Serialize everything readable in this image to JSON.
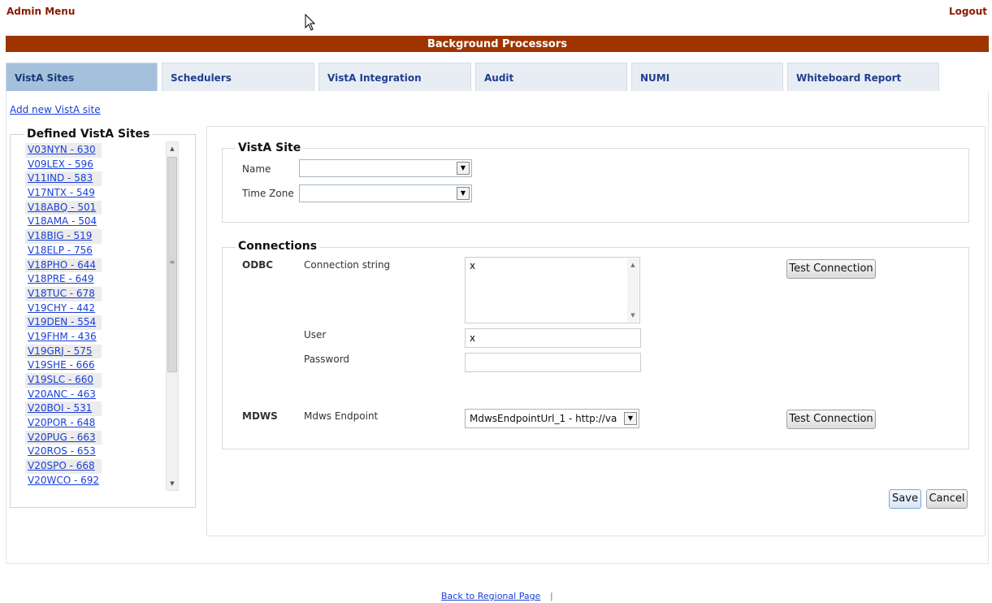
{
  "header": {
    "admin_menu": "Admin Menu",
    "logout": "Logout",
    "title": "Background Processors"
  },
  "tabs": [
    {
      "label": "VistA Sites",
      "active": true
    },
    {
      "label": "Schedulers",
      "active": false
    },
    {
      "label": "VistA Integration",
      "active": false
    },
    {
      "label": "Audit",
      "active": false
    },
    {
      "label": "NUMI",
      "active": false
    },
    {
      "label": "Whiteboard Report",
      "active": false
    }
  ],
  "add_site_link": "Add new VistA site",
  "sites": {
    "legend": "Defined VistA Sites",
    "items": [
      "V03NYN - 630",
      "V09LEX - 596",
      "V11IND - 583",
      "V17NTX - 549",
      "V18ABQ - 501",
      "V18AMA - 504",
      "V18BIG - 519",
      "V18ELP - 756",
      "V18PHO - 644",
      "V18PRE - 649",
      "V18TUC - 678",
      "V19CHY - 442",
      "V19DEN - 554",
      "V19FHM - 436",
      "V19GRJ - 575",
      "V19SHE - 666",
      "V19SLC - 660",
      "V20ANC - 463",
      "V20BOI - 531",
      "V20POR - 648",
      "V20PUG - 663",
      "V20ROS - 653",
      "V20SPO - 668",
      "V20WCO - 692"
    ]
  },
  "vista_site": {
    "legend": "VistA Site",
    "name_label": "Name",
    "name_value": "",
    "timezone_label": "Time Zone",
    "timezone_value": ""
  },
  "connections": {
    "legend": "Connections",
    "odbc_label": "ODBC",
    "connection_string_label": "Connection string",
    "connection_string_value": "x",
    "user_label": "User",
    "user_value": "x",
    "password_label": "Password",
    "password_value": "",
    "test_connection_label": "Test Connection",
    "mdws_label": "MDWS",
    "mdws_endpoint_label": "Mdws Endpoint",
    "mdws_endpoint_value": "MdwsEndpointUrl_1 - http://va"
  },
  "actions": {
    "save": "Save",
    "cancel": "Cancel"
  },
  "footer": {
    "back_link": "Back to Regional Page",
    "separator": "|"
  },
  "colors": {
    "title_bar": "#9e3500",
    "active_tab": "#a4c0dd",
    "inactive_tab": "#e8edf4",
    "link": "#1a3fd6"
  }
}
